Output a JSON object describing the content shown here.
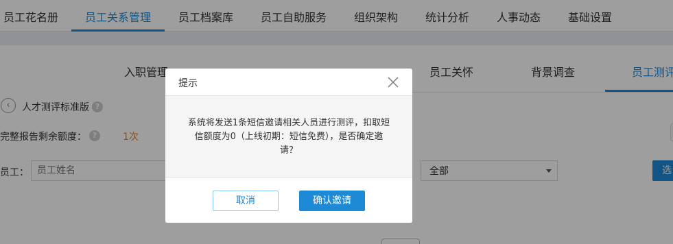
{
  "topnav": {
    "items": [
      "员工花名册",
      "员工关系管理",
      "员工档案库",
      "员工自助服务",
      "组织架构",
      "统计分析",
      "人事动态",
      "基础设置"
    ],
    "active_index": 1
  },
  "subtabs": {
    "items": [
      "入职管理",
      "员工关怀",
      "背景调查",
      "员工测评"
    ],
    "active": "员工测评"
  },
  "page": {
    "crumb": "人才测评标准版",
    "quota_label": "完整报告剩余额度：",
    "quota_value": "1次",
    "employee_label": "员工：",
    "employee_placeholder": "员工姓名",
    "filter_colon": "：",
    "filter_selected": "全部",
    "search_button": "选"
  },
  "modal": {
    "title": "提示",
    "message": "系统将发送1条短信邀请相关人员进行测评，扣取短信额度为0（上线初期：短信免费），是否确定邀请？",
    "cancel": "取消",
    "confirm": "确认邀请"
  },
  "colors": {
    "accent": "#1e8ad6",
    "quota": "#e67e22",
    "overlay": "rgba(0,0,0,0.38)"
  },
  "icons": {
    "back": "back-arrow-icon",
    "help": "question-icon",
    "close": "close-icon",
    "dropdown": "caret-down-icon"
  }
}
